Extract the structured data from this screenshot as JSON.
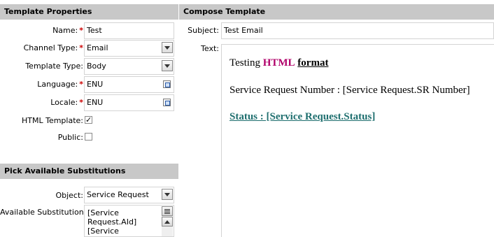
{
  "template_properties": {
    "header": "Template Properties",
    "name": {
      "label": "Name:",
      "value": "Test",
      "required": "*"
    },
    "channel_type": {
      "label": "Channel Type:",
      "value": "Email",
      "required": "*"
    },
    "template_type": {
      "label": "Template Type:",
      "value": "Body"
    },
    "language": {
      "label": "Language:",
      "value": "ENU",
      "required": "*"
    },
    "locale": {
      "label": "Locale:",
      "value": "ENU",
      "required": "*"
    },
    "html_template": {
      "label": "HTML Template:",
      "checked": true,
      "mark": "✓"
    },
    "public": {
      "label": "Public:",
      "checked": false
    }
  },
  "substitutions": {
    "header": "Pick Available Substitutions",
    "object": {
      "label": "Object:",
      "value": "Service Request"
    },
    "available": {
      "label": "Available Substitutions:",
      "visible_text": "[Service Request.AId] [Service"
    }
  },
  "compose": {
    "header": "Compose Template",
    "subject": {
      "label": "Subject:",
      "value": "Test Email"
    },
    "text_label": "Text:",
    "body": {
      "line1_prefix": "Testing ",
      "line1_html": "HTML",
      "line1_space": " ",
      "line1_format": "format",
      "line2": "Service Request Number : [Service Request.SR Number]",
      "line3": "Status : [Service Request.Status]"
    }
  },
  "colors": {
    "header_bg": "#c8c8c8",
    "required": "#cc0000",
    "html_word": "#b0006a",
    "status_link": "#1f6f6f"
  },
  "icons": [
    "chevron-down-icon",
    "pick-list-icon",
    "checkbox-icon",
    "scroll-up-icon",
    "list-menu-icon"
  ]
}
